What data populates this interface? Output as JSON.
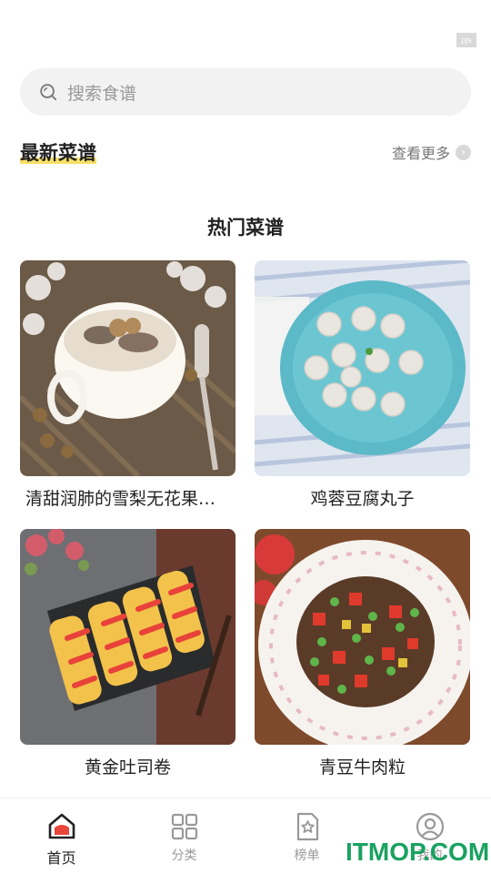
{
  "corner_badge": "pjs",
  "search": {
    "placeholder": "搜索食谱"
  },
  "latest": {
    "title": "最新菜谱",
    "more_label": "查看更多"
  },
  "hot": {
    "title": "热门菜谱",
    "recipes": [
      {
        "name": "清甜润肺的雪梨无花果…"
      },
      {
        "name": "鸡蓉豆腐丸子"
      },
      {
        "name": "黄金吐司卷"
      },
      {
        "name": "青豆牛肉粒"
      }
    ]
  },
  "tabbar": {
    "items": [
      {
        "label": "首页",
        "icon": "home-icon",
        "active": true
      },
      {
        "label": "分类",
        "icon": "grid-icon",
        "active": false
      },
      {
        "label": "榜单",
        "icon": "star-list-icon",
        "active": false
      },
      {
        "label": "我的",
        "icon": "user-icon",
        "active": false
      }
    ]
  },
  "watermark": "ITMOP.COM",
  "colors": {
    "highlight": "#f7e067",
    "home_accent": "#e8463a",
    "watermark": "#1aa260"
  }
}
